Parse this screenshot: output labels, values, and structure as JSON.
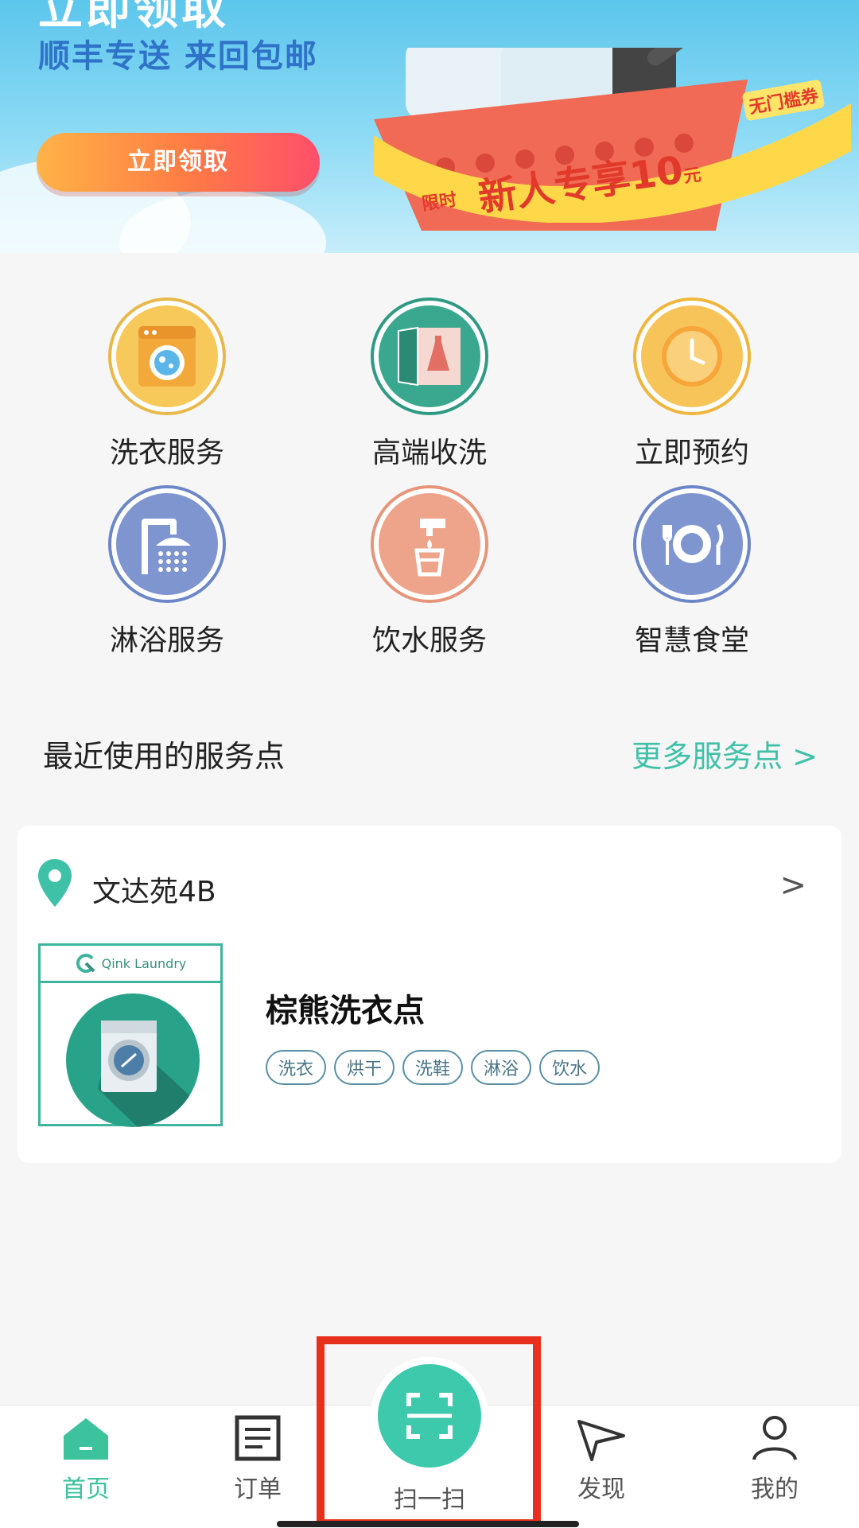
{
  "banner": {
    "headline_top": "立即领取",
    "headline": "顺丰专送  来回包邮",
    "cta_label": "立即领取",
    "ribbon_prefix": "限时",
    "ribbon_text": "新人专享10",
    "ribbon_unit": "元",
    "ribbon_tag": "无门槛券"
  },
  "services": [
    {
      "label": "洗衣服务",
      "icon": "washing-machine-icon",
      "ring": "#e8b84a",
      "fill": "#f7c95a"
    },
    {
      "label": "高端收洗",
      "icon": "wardrobe-dress-icon",
      "ring": "#2f9a82",
      "fill": "#3aa88f"
    },
    {
      "label": "立即预约",
      "icon": "clock-icon",
      "ring": "#f0b53c",
      "fill": "#f7c45a"
    },
    {
      "label": "淋浴服务",
      "icon": "shower-icon",
      "ring": "#6c86c8",
      "fill": "#7e95d0"
    },
    {
      "label": "饮水服务",
      "icon": "water-tap-icon",
      "ring": "#e7957a",
      "fill": "#eea48a"
    },
    {
      "label": "智慧食堂",
      "icon": "plate-cutlery-icon",
      "ring": "#6c86c8",
      "fill": "#7e95d0"
    }
  ],
  "recent": {
    "title": "最近使用的服务点",
    "more_label": "更多服务点 >"
  },
  "location": {
    "name": "文达苑4B",
    "arrow": ">",
    "store": {
      "logo_text": "Qink Laundry",
      "name": "棕熊洗衣点",
      "tags": [
        "洗衣",
        "烘干",
        "洗鞋",
        "淋浴",
        "饮水"
      ]
    }
  },
  "nav": {
    "home": "首页",
    "orders": "订单",
    "scan": "扫一扫",
    "discover": "发现",
    "mine": "我的"
  },
  "colors": {
    "accent": "#3cc29d",
    "highlight": "#e8301f"
  }
}
